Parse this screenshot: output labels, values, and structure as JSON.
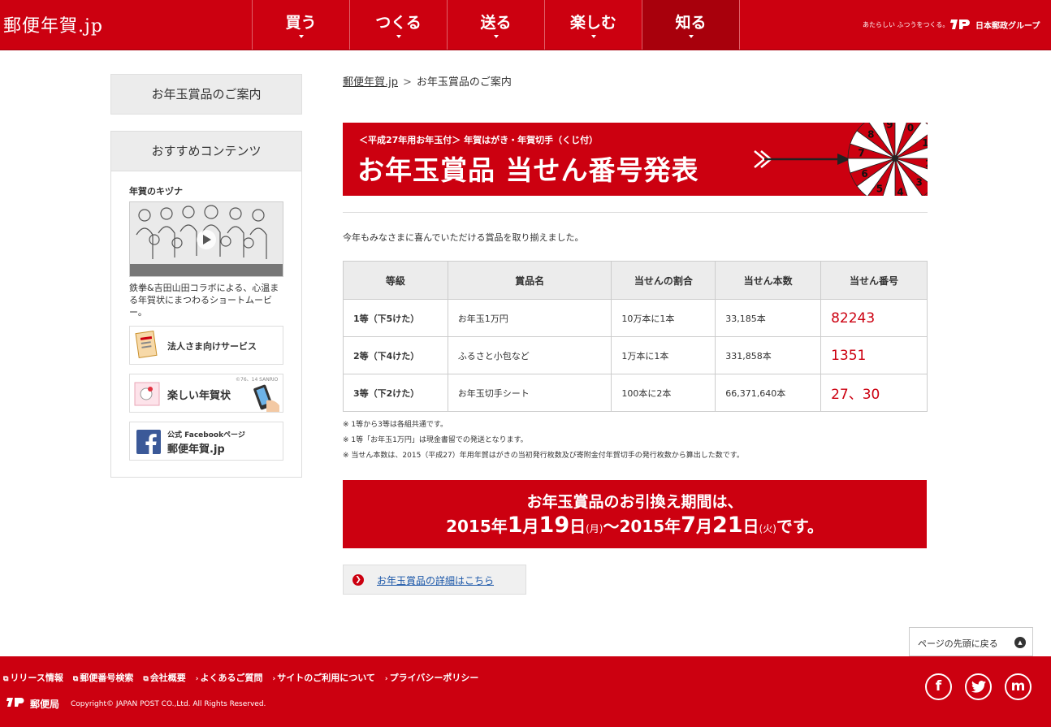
{
  "header": {
    "logo": "郵便年賀.jp",
    "nav": [
      {
        "label": "買う"
      },
      {
        "label": "つくる"
      },
      {
        "label": "送る"
      },
      {
        "label": "楽しむ"
      },
      {
        "label": "知る"
      }
    ],
    "tagline": "あたらしい ふつうをつくる。",
    "group_name": "日本郵政グループ"
  },
  "sidebar": {
    "guide": "お年玉賞品のご案内",
    "recommend_heading": "おすすめコンテンツ",
    "kizuna_title": "年賀のキヅナ",
    "kizuna_desc": "鉄拳&吉田山田コラボによる、心温まる年賀状にまつわるショートムービー。",
    "banners": {
      "corporate": "法人さま向けサービス",
      "fun": "楽しい年賀状",
      "fun_credit": "©76、14 SANRIO",
      "fb_small": "公式 Facebookページ",
      "fb_big": "郵便年賀.jp"
    }
  },
  "breadcrumb": {
    "home": "郵便年賀.jp",
    "current": "お年玉賞品のご案内"
  },
  "hero": {
    "sub": "＜平成27年用お年玉付＞ 年賀はがき・年賀切手（くじ付）",
    "title": "お年玉賞品 当せん番号発表",
    "wheel_numbers": [
      "0",
      "1",
      "2",
      "3",
      "4",
      "5",
      "6",
      "7",
      "8",
      "9"
    ]
  },
  "intro": "今年もみなさまに喜んでいただける賞品を取り揃えました。",
  "table": {
    "headers": [
      "等級",
      "賞品名",
      "当せんの割合",
      "当せん本数",
      "当せん番号"
    ],
    "rows": [
      {
        "grade": "1等（下5けた）",
        "prize": "お年玉1万円",
        "ratio": "10万本に1本",
        "count": "33,185本",
        "number": "82243"
      },
      {
        "grade": "2等（下4けた）",
        "prize": "ふるさと小包など",
        "ratio": "1万本に1本",
        "count": "331,858本",
        "number": "1351"
      },
      {
        "grade": "3等（下2けた）",
        "prize": "お年玉切手シート",
        "ratio": "100本に2本",
        "count": "66,371,640本",
        "number": "27、30"
      }
    ]
  },
  "notes": [
    "※ 1等から3等は各組共通です。",
    "※ 1等「お年玉1万円」は現金書留での発送となります。",
    "※ 当せん本数は、2015（平成27）年用年賀はがきの当初発行枚数及び寄附金付年賀切手の発行枚数から算出した数です。"
  ],
  "period": {
    "line1": "お年玉賞品のお引換え期間は、",
    "start_year": "2015年",
    "start_month": "1",
    "start_month_unit": "月",
    "start_day": "19",
    "start_day_unit": "日",
    "start_dow": "(月)",
    "tilde": "～",
    "end_year": "2015年",
    "end_month": "7",
    "end_month_unit": "月",
    "end_day": "21",
    "end_day_unit": "日",
    "end_dow": "(火)",
    "suffix": "です。"
  },
  "detail_link": "お年玉賞品の詳細はこちら",
  "pagetop": "ページの先頭に戻る",
  "footer": {
    "links": [
      {
        "mark": "⧉",
        "label": "リリース情報"
      },
      {
        "mark": "⧉",
        "label": "郵便番号検索"
      },
      {
        "mark": "⧉",
        "label": "会社概要"
      },
      {
        "mark": "›",
        "label": "よくあるご質問"
      },
      {
        "mark": "›",
        "label": "サイトのご利用について"
      },
      {
        "mark": "›",
        "label": "プライバシーポリシー"
      }
    ],
    "post_name": "郵便局",
    "copyright": "Copyright© JAPAN POST CO.,Ltd. All Rights Reserved.",
    "social": [
      "facebook-icon",
      "twitter-icon",
      "mixi-icon"
    ]
  },
  "colors": {
    "brand_red": "#cc0010",
    "link_blue": "#1a56a8"
  }
}
